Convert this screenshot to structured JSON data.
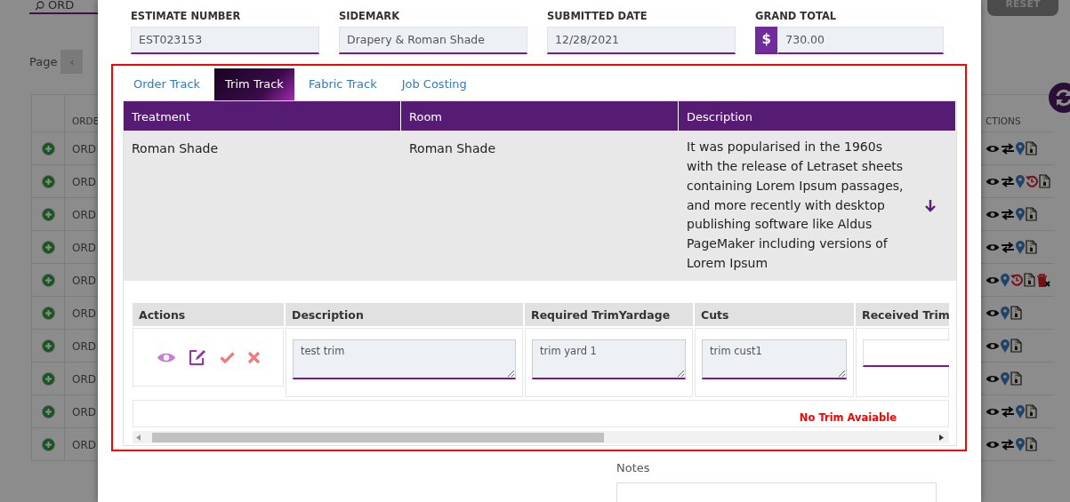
{
  "background": {
    "search": {
      "value": "ORD"
    },
    "pagination": {
      "label": "Page",
      "prev": "‹"
    },
    "reset_button": "RESET",
    "table": {
      "column_1": "ORDE",
      "actions_header": "CTIONS",
      "rows": [
        {
          "order": "ORD",
          "actions": [
            {
              "kind": "view"
            },
            {
              "kind": "swap"
            },
            {
              "kind": "location"
            },
            {
              "kind": "file"
            }
          ]
        },
        {
          "order": "ORD",
          "actions": [
            {
              "kind": "view"
            },
            {
              "kind": "swap"
            },
            {
              "kind": "location"
            },
            {
              "kind": "history"
            },
            {
              "kind": "file"
            }
          ]
        },
        {
          "order": "ORD",
          "actions": [
            {
              "kind": "view"
            },
            {
              "kind": "swap"
            },
            {
              "kind": "location"
            },
            {
              "kind": "file"
            }
          ]
        },
        {
          "order": "ORD",
          "actions": [
            {
              "kind": "view"
            },
            {
              "kind": "swap"
            },
            {
              "kind": "location"
            },
            {
              "kind": "file"
            }
          ]
        },
        {
          "order": "ORD",
          "actions": [
            {
              "kind": "view"
            },
            {
              "kind": "location"
            },
            {
              "kind": "history"
            },
            {
              "kind": "file"
            },
            {
              "kind": "delete"
            }
          ]
        },
        {
          "order": "ORD",
          "actions": [
            {
              "kind": "view"
            },
            {
              "kind": "location"
            },
            {
              "kind": "file"
            }
          ]
        },
        {
          "order": "ORD",
          "actions": [
            {
              "kind": "view"
            },
            {
              "kind": "location"
            },
            {
              "kind": "file"
            }
          ]
        },
        {
          "order": "ORD",
          "actions": [
            {
              "kind": "view"
            },
            {
              "kind": "location"
            },
            {
              "kind": "file"
            }
          ]
        },
        {
          "order": "ORD",
          "actions": [
            {
              "kind": "view"
            },
            {
              "kind": "swap"
            },
            {
              "kind": "location"
            },
            {
              "kind": "file"
            }
          ]
        },
        {
          "order": "ORD",
          "actions": [
            {
              "kind": "view"
            },
            {
              "kind": "swap"
            },
            {
              "kind": "location"
            },
            {
              "kind": "file"
            }
          ]
        }
      ]
    }
  },
  "modal": {
    "fields": [
      {
        "label": "ESTIMATE NUMBER",
        "value": "EST023153",
        "kind": "text"
      },
      {
        "label": "SIDEMARK",
        "value": "Drapery & Roman Shade",
        "kind": "text"
      },
      {
        "label": "SUBMITTED DATE",
        "value": "12/28/2021",
        "kind": "text"
      },
      {
        "label": "GRAND TOTAL",
        "value": "730.00",
        "kind": "currency",
        "prefix": "$"
      }
    ],
    "tabs": [
      {
        "label": "Order Track",
        "selected": false
      },
      {
        "label": "Trim Track",
        "selected": true
      },
      {
        "label": "Fabric Track",
        "selected": false
      },
      {
        "label": "Job Costing",
        "selected": false
      }
    ],
    "treatment_table": {
      "columns": [
        "Treatment",
        "Room",
        "Description"
      ],
      "rows": [
        {
          "treatment": "Roman Shade",
          "room": "Roman Shade",
          "description": "It was popularised in the 1960s with the release of Letraset sheets containing Lorem Ipsum passages, and more recently with desktop publishing software like Aldus PageMaker including versions of Lorem Ipsum"
        }
      ]
    },
    "trim_table": {
      "columns": [
        "Actions",
        "Description",
        "Required TrimYardage",
        "Cuts",
        "Received Trim"
      ],
      "rows": [
        {
          "actions": [
            {
              "kind": "view"
            },
            {
              "kind": "edit"
            },
            {
              "kind": "approve"
            },
            {
              "kind": "remove"
            }
          ],
          "description": "test trim",
          "required_yardage": "trim yard 1",
          "cuts": "trim cust1"
        }
      ],
      "empty_message": "No Trim Avaiable"
    },
    "notes": {
      "label": "Notes"
    }
  }
}
